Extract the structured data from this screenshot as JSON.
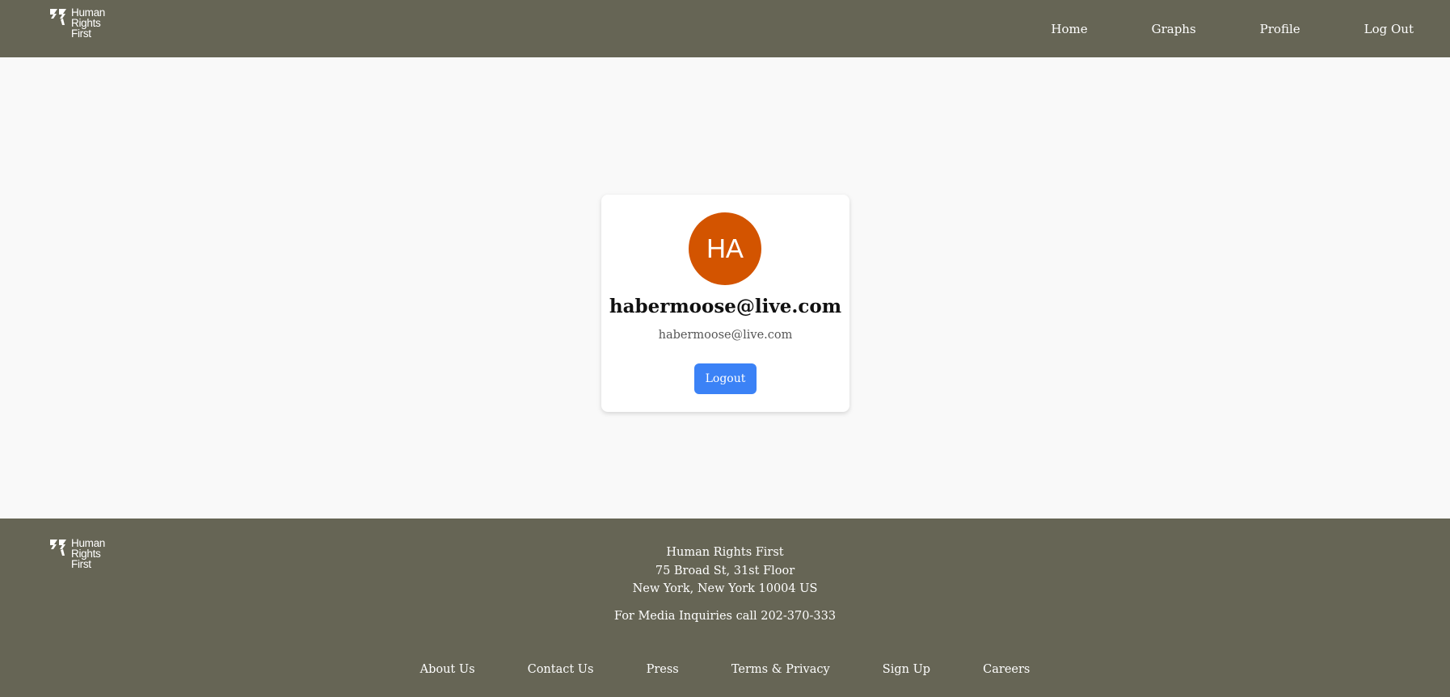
{
  "header": {
    "logo_text": "Human\nRights\nFirst",
    "nav": [
      "Home",
      "Graphs",
      "Profile",
      "Log Out"
    ]
  },
  "profile": {
    "initials": "HA",
    "name": "habermoose@live.com",
    "email": "habermoose@live.com",
    "logout_label": "Logout"
  },
  "footer": {
    "logo_text": "Human\nRights\nFirst",
    "address": [
      "Human Rights First",
      "75 Broad St, 31st Floor",
      "New York, New York 10004 US"
    ],
    "media": "For Media Inquiries call 202-370-333",
    "links": [
      "About Us",
      "Contact Us",
      "Press",
      "Terms & Privacy",
      "Sign Up",
      "Careers"
    ]
  },
  "colors": {
    "bar": "#666555",
    "avatar": "#d35400",
    "button": "#3b82f6",
    "background": "#f9f9f9"
  }
}
